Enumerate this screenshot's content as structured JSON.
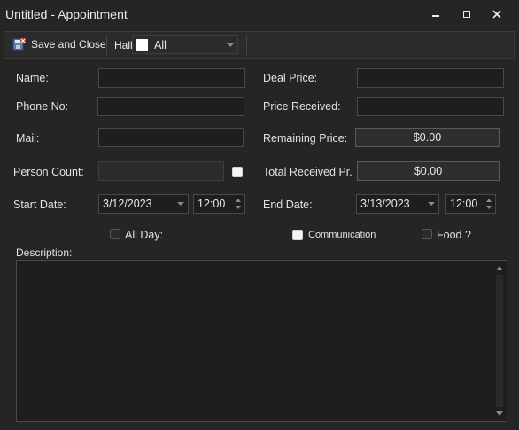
{
  "window": {
    "title": "Untitled - Appointment",
    "minimize_icon": "minimize-icon",
    "maximize_icon": "maximize-icon",
    "close_icon": "close-icon"
  },
  "toolbar": {
    "save_close_label": "Save and Close",
    "save_icon": "save-close-icon",
    "hall_label": "Hall",
    "hall_value": "All"
  },
  "form": {
    "name_label": "Name:",
    "name_value": "",
    "phone_label": "Phone No:",
    "phone_value": "",
    "mail_label": "Mail:",
    "mail_value": "",
    "person_count_label": "Person Count:",
    "person_count_value": "",
    "person_count_checked": false,
    "deal_price_label": "Deal Price:",
    "deal_price_value": "",
    "price_received_label": "Price Received:",
    "price_received_value": "",
    "remaining_price_label": "Remaining Price:",
    "remaining_price_value": "$0.00",
    "total_received_label": "Total Received Pr.",
    "total_received_value": "$0.00",
    "start_date_label": "Start Date:",
    "start_date_value": "3/12/2023",
    "start_time_value": "12:00",
    "end_date_label": "End Date:",
    "end_date_value": "3/13/2023",
    "end_time_value": "12:00",
    "all_day_label": "All Day:",
    "all_day_checked": false,
    "communication_label": "Communication",
    "communication_checked": false,
    "food_label": "Food ?",
    "food_checked": false,
    "description_label": "Description:",
    "description_value": ""
  },
  "colors": {
    "background": "#252525",
    "field_background": "#1e1e1e",
    "border": "#484848",
    "text": "#e2e2e2"
  }
}
